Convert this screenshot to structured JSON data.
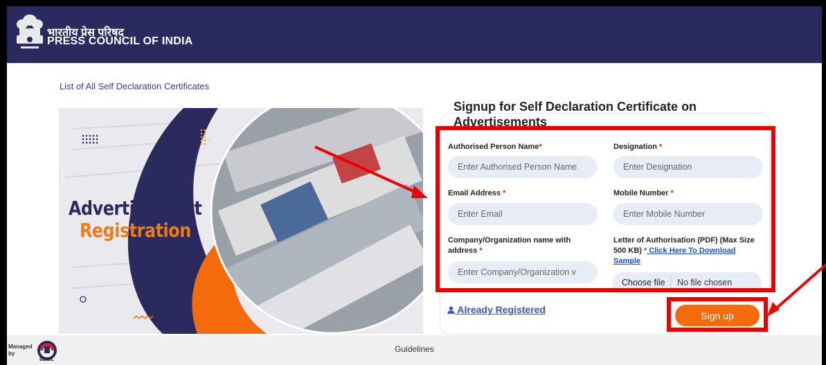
{
  "header": {
    "title_hindi": "भारतीय प्रेस परिषद",
    "title_en": "PRESS COUNCIL OF INDIA"
  },
  "links": {
    "list_certificates": "List of All Self Declaration Certificates"
  },
  "hero": {
    "line1": "Advertisement",
    "line2": "Registration"
  },
  "form": {
    "title": "Signup for Self Declaration Certificate on Advertisements",
    "fields": {
      "authorised_name": {
        "label": "Authorised Person Name",
        "required": "*",
        "placeholder": "Enter Authorised Person Name"
      },
      "designation": {
        "label": "Designation",
        "required": "*",
        "placeholder": "Enter Designation"
      },
      "email": {
        "label": "Email Address",
        "required": "*",
        "placeholder": "Enter Email"
      },
      "mobile": {
        "label": "Mobile Number",
        "required": "*",
        "placeholder": "Enter Mobile Number"
      },
      "company": {
        "label": "Company/Organization name with address",
        "required": "*",
        "placeholder": "Enter Company/Organization v"
      },
      "letter": {
        "label": "Letter of Authorisation (PDF) (Max Size 500 KB)",
        "required": "*",
        "download_link": " Click Here To Download Sample"
      }
    },
    "file_input": {
      "button": "Choose file",
      "status": "No file chosen"
    },
    "already_registered": "Already Registered",
    "signup_button": "Sign up"
  },
  "footer": {
    "guidelines": "Guidelines",
    "managed_by": "Managed by",
    "partner": "BECIL"
  },
  "colors": {
    "header_bg": "#2b2a5e",
    "accent_orange": "#f36b0c",
    "annotation_red": "#ee0000",
    "input_bg": "#e8ecf7"
  }
}
